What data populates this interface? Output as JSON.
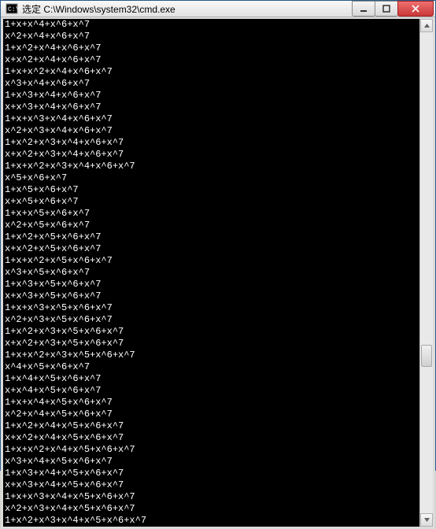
{
  "window": {
    "title": "选定 C:\\Windows\\system32\\cmd.exe"
  },
  "console": {
    "lines": [
      "1+x+x^4+x^6+x^7",
      "x^2+x^4+x^6+x^7",
      "1+x^2+x^4+x^6+x^7",
      "x+x^2+x^4+x^6+x^7",
      "1+x+x^2+x^4+x^6+x^7",
      "x^3+x^4+x^6+x^7",
      "1+x^3+x^4+x^6+x^7",
      "x+x^3+x^4+x^6+x^7",
      "1+x+x^3+x^4+x^6+x^7",
      "x^2+x^3+x^4+x^6+x^7",
      "1+x^2+x^3+x^4+x^6+x^7",
      "x+x^2+x^3+x^4+x^6+x^7",
      "1+x+x^2+x^3+x^4+x^6+x^7",
      "x^5+x^6+x^7",
      "1+x^5+x^6+x^7",
      "x+x^5+x^6+x^7",
      "1+x+x^5+x^6+x^7",
      "x^2+x^5+x^6+x^7",
      "1+x^2+x^5+x^6+x^7",
      "x+x^2+x^5+x^6+x^7",
      "1+x+x^2+x^5+x^6+x^7",
      "x^3+x^5+x^6+x^7",
      "1+x^3+x^5+x^6+x^7",
      "x+x^3+x^5+x^6+x^7",
      "1+x+x^3+x^5+x^6+x^7",
      "x^2+x^3+x^5+x^6+x^7",
      "1+x^2+x^3+x^5+x^6+x^7",
      "x+x^2+x^3+x^5+x^6+x^7",
      "1+x+x^2+x^3+x^5+x^6+x^7",
      "x^4+x^5+x^6+x^7",
      "1+x^4+x^5+x^6+x^7",
      "x+x^4+x^5+x^6+x^7",
      "1+x+x^4+x^5+x^6+x^7",
      "x^2+x^4+x^5+x^6+x^7",
      "1+x^2+x^4+x^5+x^6+x^7",
      "x+x^2+x^4+x^5+x^6+x^7",
      "1+x+x^2+x^4+x^5+x^6+x^7",
      "x^3+x^4+x^5+x^6+x^7",
      "1+x^3+x^4+x^5+x^6+x^7",
      "x+x^3+x^4+x^5+x^6+x^7",
      "1+x+x^3+x^4+x^5+x^6+x^7",
      "x^2+x^3+x^4+x^5+x^6+x^7",
      "1+x^2+x^3+x^4+x^5+x^6+x^7"
    ]
  }
}
